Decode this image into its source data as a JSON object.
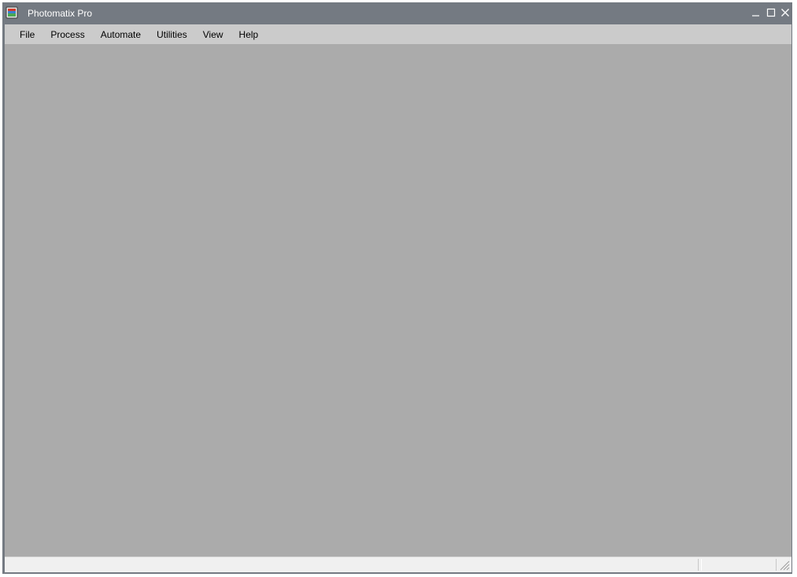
{
  "window": {
    "title": "Photomatix Pro",
    "icon": "photomatix-app-icon",
    "controls": {
      "minimize_icon": "minimize-icon",
      "maximize_icon": "maximize-icon",
      "close_icon": "close-icon"
    }
  },
  "menubar": {
    "items": [
      {
        "label": "File"
      },
      {
        "label": "Process"
      },
      {
        "label": "Automate"
      },
      {
        "label": "Utilities"
      },
      {
        "label": "View"
      },
      {
        "label": "Help"
      }
    ]
  },
  "statusbar": {
    "main_text": "",
    "secondary_text": ""
  },
  "colors": {
    "titlebar": "#747a82",
    "menubar": "#cbcbcb",
    "workspace": "#ababab",
    "statusbar": "#f0f0f0"
  }
}
